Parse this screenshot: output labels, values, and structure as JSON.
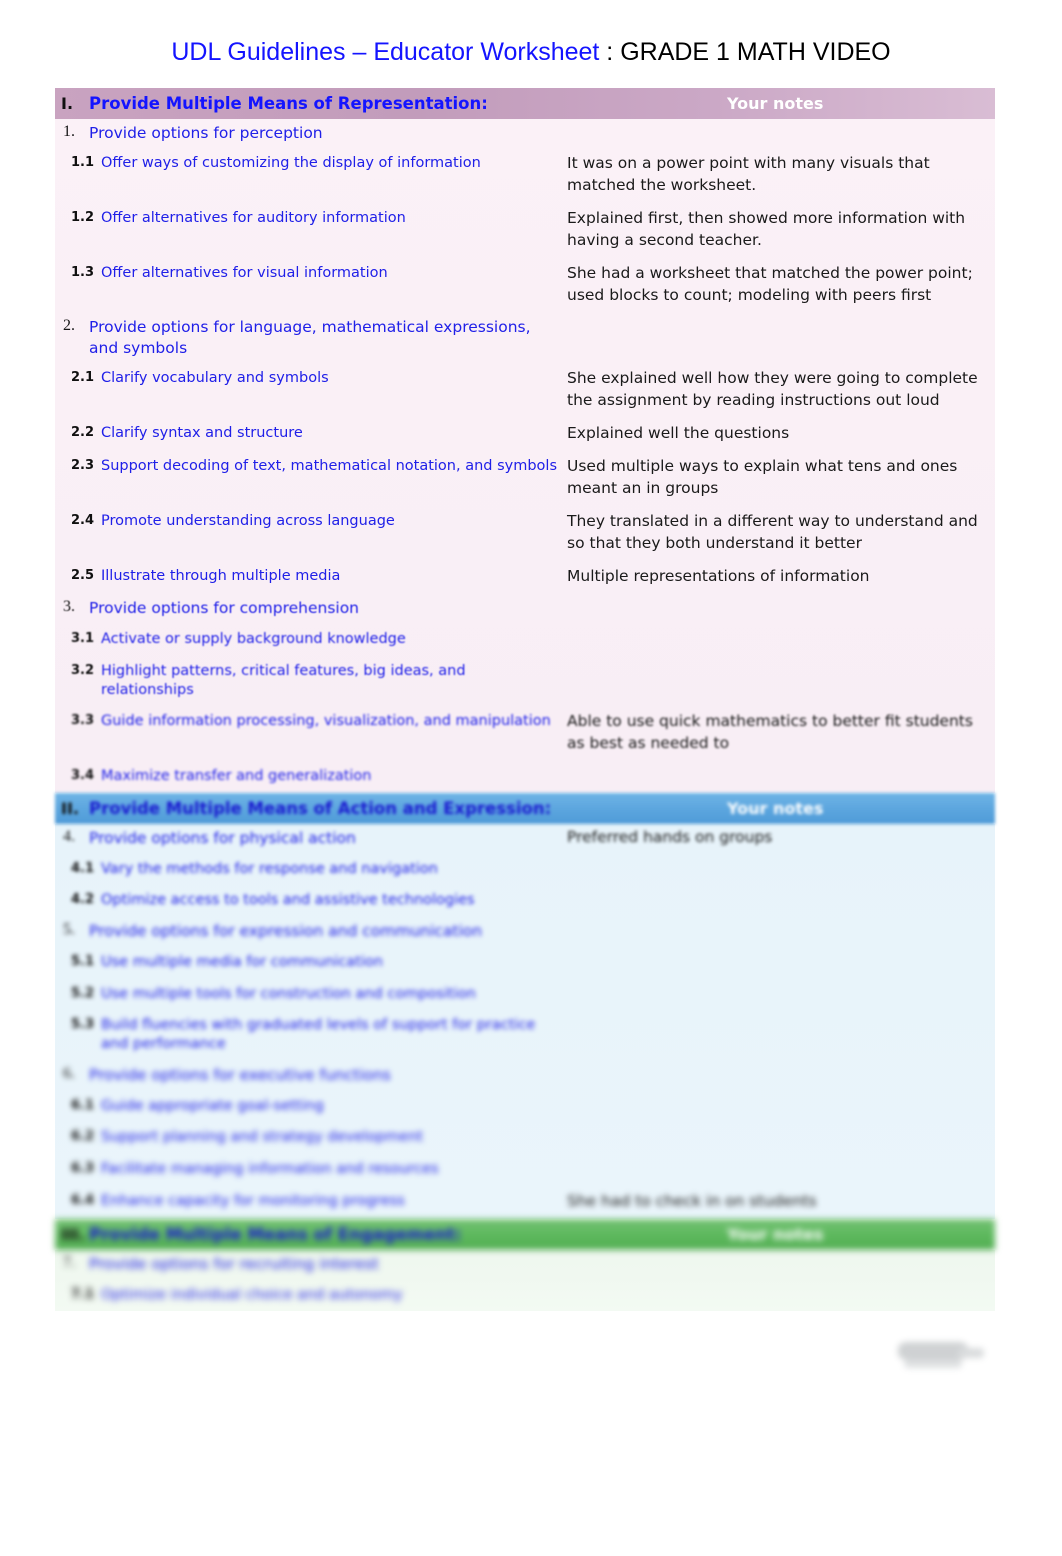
{
  "title": {
    "main": "UDL Guidelines – Educator Worksheet",
    "separator": " : ",
    "subject": "GRADE 1 MATH VIDEO"
  },
  "notes_column_header": "Your notes",
  "colors": {
    "title_blue": "#1414ff",
    "link_blue": "#2020e8",
    "band_representation": "#c29cbb",
    "band_action": "#5ba5de",
    "band_engagement": "#5cb85c",
    "body_pink": "#f9eff6",
    "body_blue": "#e8f4fa",
    "body_green": "#f0f8f0"
  },
  "sections": [
    {
      "roman": "I.",
      "title": "Provide Multiple Means of Representation:",
      "band_class": "band-purple",
      "body_class": "sec-pink",
      "guidelines": [
        {
          "number": "1.",
          "title": "Provide options for perception",
          "checkpoints": [
            {
              "id": "1.1",
              "text": "Offer ways of customizing the display of information",
              "note": "It was on a power point with many visuals that matched the worksheet."
            },
            {
              "id": "1.2",
              "text": "Offer alternatives for auditory information",
              "note": "Explained first, then showed more information with having a second teacher."
            },
            {
              "id": "1.3",
              "text": "Offer alternatives for visual information",
              "note": "She had a worksheet that matched the power point; used blocks to count; modeling with peers first"
            }
          ]
        },
        {
          "number": "2.",
          "title": "Provide options for language, mathematical expressions, and symbols",
          "checkpoints": [
            {
              "id": "2.1",
              "text": "Clarify vocabulary and symbols",
              "note": "She explained well how they were going to complete the assignment by reading instructions out loud"
            },
            {
              "id": "2.2",
              "text": "Clarify syntax and structure",
              "note": "Explained well the questions"
            },
            {
              "id": "2.3",
              "text": "Support decoding of text, mathematical notation, and symbols",
              "note": "Used multiple ways to explain what tens and ones meant an in groups"
            },
            {
              "id": "2.4",
              "text": "Promote understanding across language",
              "note": "They translated in a different way to understand and so that they both understand it better"
            },
            {
              "id": "2.5",
              "text": "Illustrate through multiple media",
              "note": "Multiple representations of information"
            }
          ]
        },
        {
          "number": "3.",
          "title": "Provide options for comprehension",
          "checkpoints": [
            {
              "id": "3.1",
              "text": "Activate or supply background knowledge",
              "note": ""
            },
            {
              "id": "3.2",
              "text": "Highlight patterns, critical features, big ideas, and relationships",
              "note": ""
            },
            {
              "id": "3.3",
              "text": "Guide information processing, visualization, and manipulation",
              "note": "Able to use quick mathematics to better fit students as best as needed to"
            },
            {
              "id": "3.4",
              "text": "Maximize transfer and generalization",
              "note": ""
            }
          ]
        }
      ]
    },
    {
      "roman": "II.",
      "title": "Provide Multiple Means of Action and Expression:",
      "band_class": "band-blue",
      "body_class": "sec-blue",
      "guidelines": [
        {
          "number": "4.",
          "title": "Provide options for physical action",
          "header_note": "Preferred hands on groups",
          "checkpoints": [
            {
              "id": "4.1",
              "text": "Vary the methods for response and navigation",
              "note": ""
            },
            {
              "id": "4.2",
              "text": "Optimize access to tools and assistive technologies",
              "note": ""
            }
          ]
        },
        {
          "number": "5.",
          "title": "Provide options for expression and communication",
          "checkpoints": [
            {
              "id": "5.1",
              "text": "Use multiple media for communication",
              "note": ""
            },
            {
              "id": "5.2",
              "text": "Use multiple tools for construction and composition",
              "note": ""
            },
            {
              "id": "5.3",
              "text": "Build fluencies with graduated levels of support for practice and performance",
              "note": ""
            }
          ]
        },
        {
          "number": "6.",
          "title": "Provide options for executive functions",
          "checkpoints": [
            {
              "id": "6.1",
              "text": "Guide appropriate goal-setting",
              "note": ""
            },
            {
              "id": "6.2",
              "text": "Support planning and strategy development",
              "note": ""
            },
            {
              "id": "6.3",
              "text": "Facilitate managing information and resources",
              "note": ""
            },
            {
              "id": "6.4",
              "text": "Enhance capacity for monitoring progress",
              "note": "She had to check in on students"
            }
          ]
        }
      ]
    },
    {
      "roman": "III.",
      "title": "Provide Multiple Means of Engagement:",
      "band_class": "band-green",
      "body_class": "sec-green",
      "guidelines": [
        {
          "number": "7.",
          "title": "Provide options for recruiting interest",
          "checkpoints": [
            {
              "id": "7.1",
              "text": "Optimize individual choice and autonomy",
              "note": ""
            }
          ]
        }
      ]
    }
  ]
}
